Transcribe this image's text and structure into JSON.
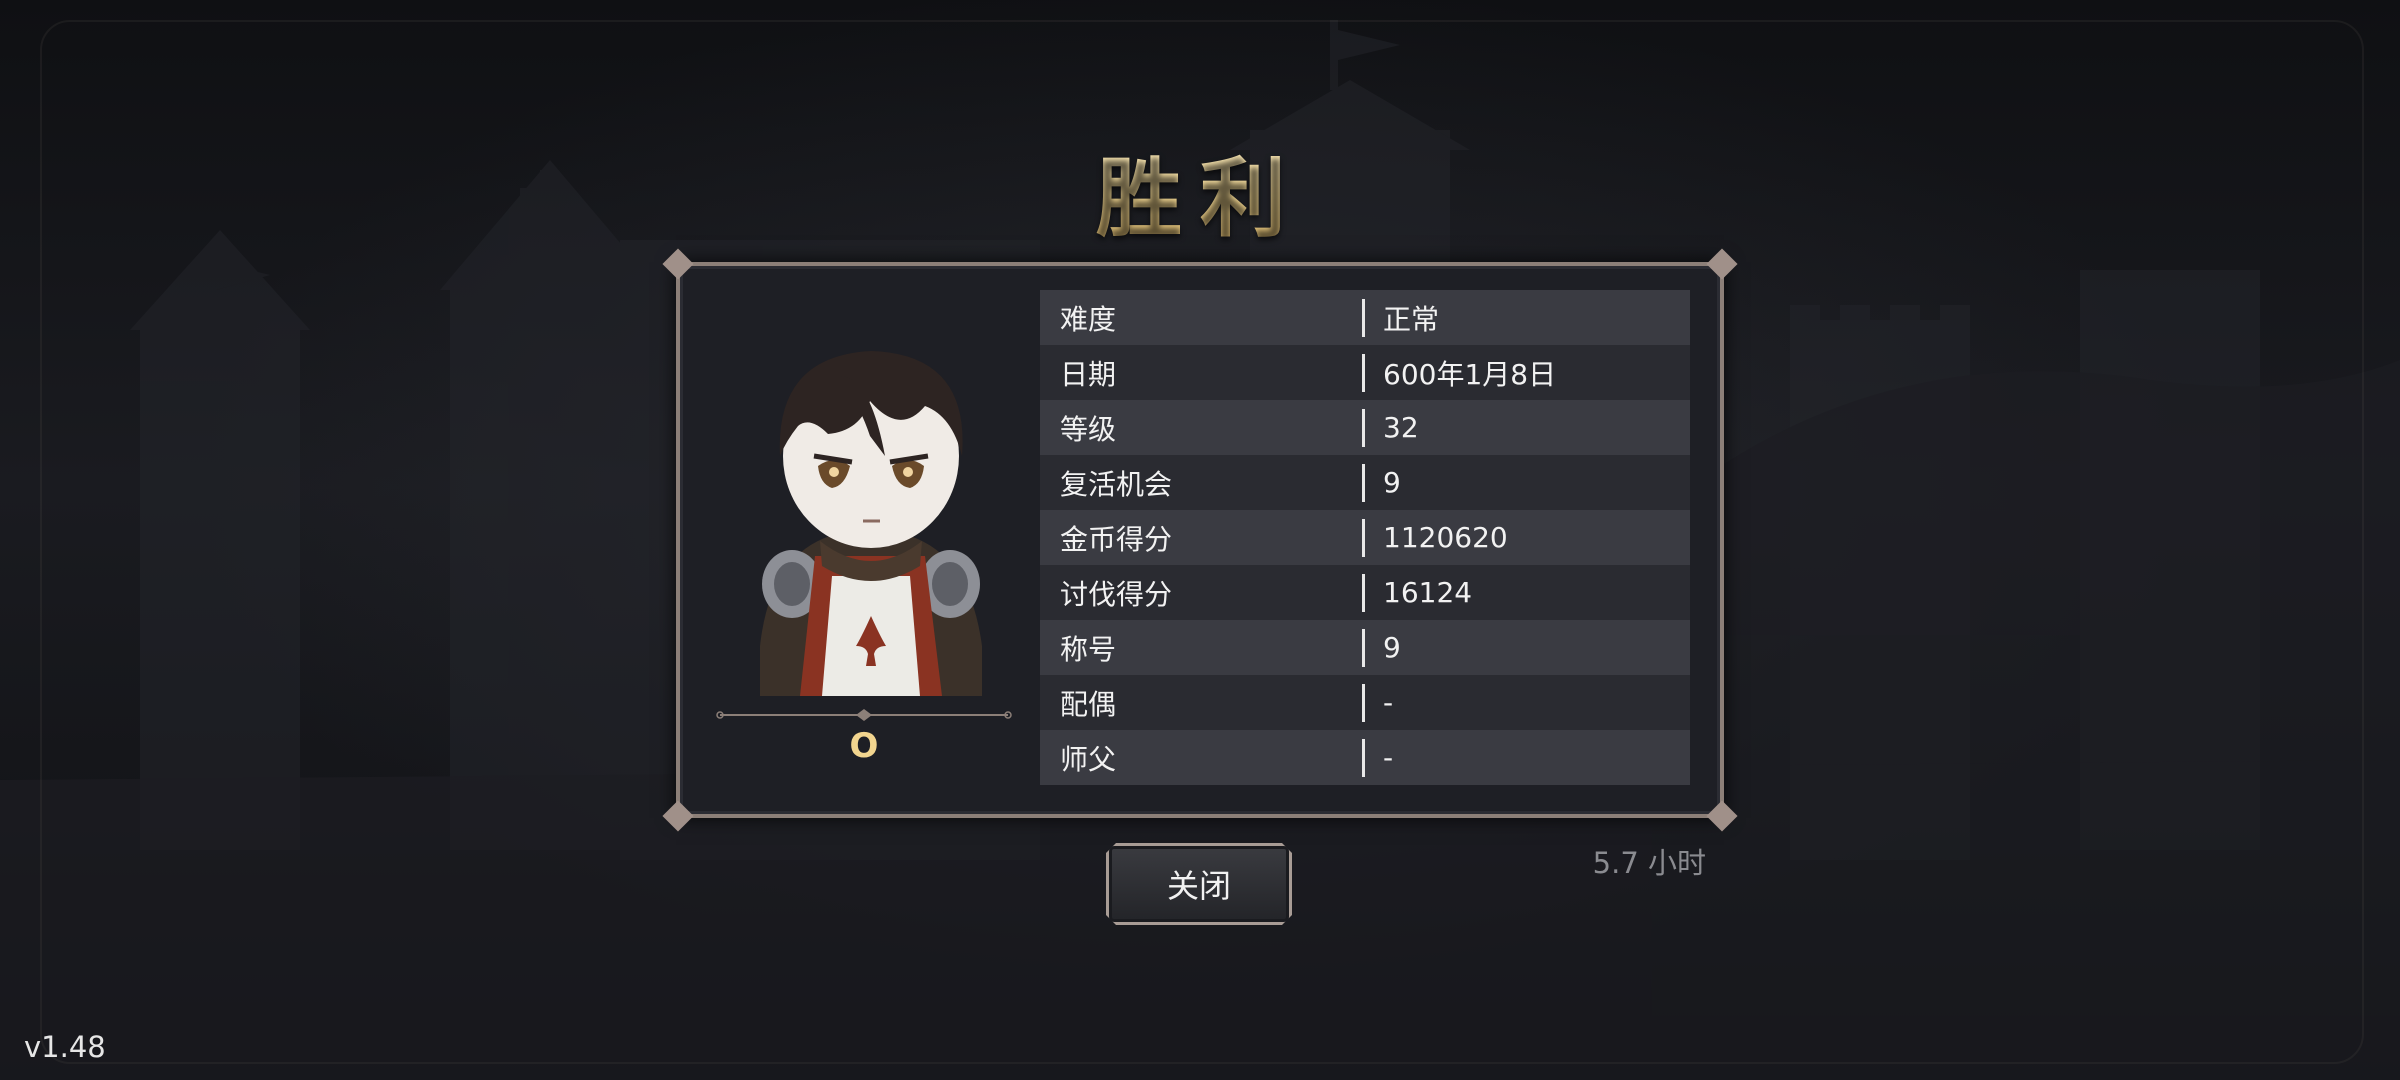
{
  "title": "胜利",
  "character": {
    "name": "O"
  },
  "stats": [
    {
      "label": "难度",
      "value": "正常"
    },
    {
      "label": "日期",
      "value": "600年1月8日"
    },
    {
      "label": "等级",
      "value": "32"
    },
    {
      "label": "复活机会",
      "value": "9"
    },
    {
      "label": "金币得分",
      "value": "1120620"
    },
    {
      "label": "讨伐得分",
      "value": "16124"
    },
    {
      "label": "称号",
      "value": "9"
    },
    {
      "label": "配偶",
      "value": "-"
    },
    {
      "label": "师父",
      "value": "-"
    }
  ],
  "close_label": "关闭",
  "playtime": "5.7 小时",
  "version": "v1.48",
  "colors": {
    "title_gold": "#f3d893",
    "panel_bg": "#1e1f25",
    "panel_border": "#8c7f78",
    "row_light": "#3a3b42",
    "row_dark": "#2a2b31"
  }
}
